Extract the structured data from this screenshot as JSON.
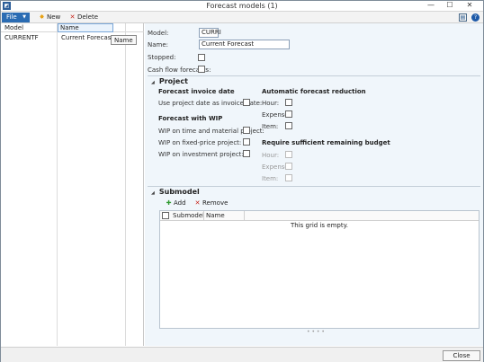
{
  "window": {
    "title": "Forecast models (1)",
    "minimize": "—",
    "maximize": "☐",
    "close": "✕"
  },
  "toolbar": {
    "file": "File",
    "new": "New",
    "delete": "Delete"
  },
  "grid": {
    "columns": [
      "Model",
      "Name"
    ],
    "rows": [
      {
        "model": "CURRENTF",
        "name": "Current Forecast"
      }
    ],
    "tooltip": "Name"
  },
  "form": {
    "model_label": "Model:",
    "model_value": "CURRI",
    "name_label": "Name:",
    "name_value": "Current Forecast",
    "stopped_label": "Stopped:",
    "cashflow_label": "Cash flow forecasts:"
  },
  "project": {
    "title": "Project",
    "invoice_date_heading": "Forecast invoice date",
    "use_project_date_label": "Use project date as invoice date:",
    "wip_heading": "Forecast with WIP",
    "wip_tm_label": "WIP on time and material project:",
    "wip_fixed_label": "WIP on fixed-price project:",
    "wip_investment_label": "WIP on investment project:",
    "auto_reduction_heading": "Automatic forecast reduction",
    "hour_label": "Hour:",
    "expense_label": "Expense:",
    "item_label": "Item:",
    "budget_heading": "Require sufficient remaining budget",
    "budget_hour_label": "Hour:",
    "budget_expense_label": "Expense:",
    "budget_item_label": "Item:"
  },
  "submodel": {
    "title": "Submodel",
    "add": "Add",
    "remove": "Remove",
    "columns": [
      "Submodel",
      "Name"
    ],
    "empty": "This grid is empty."
  },
  "footer": {
    "close": "Close"
  }
}
